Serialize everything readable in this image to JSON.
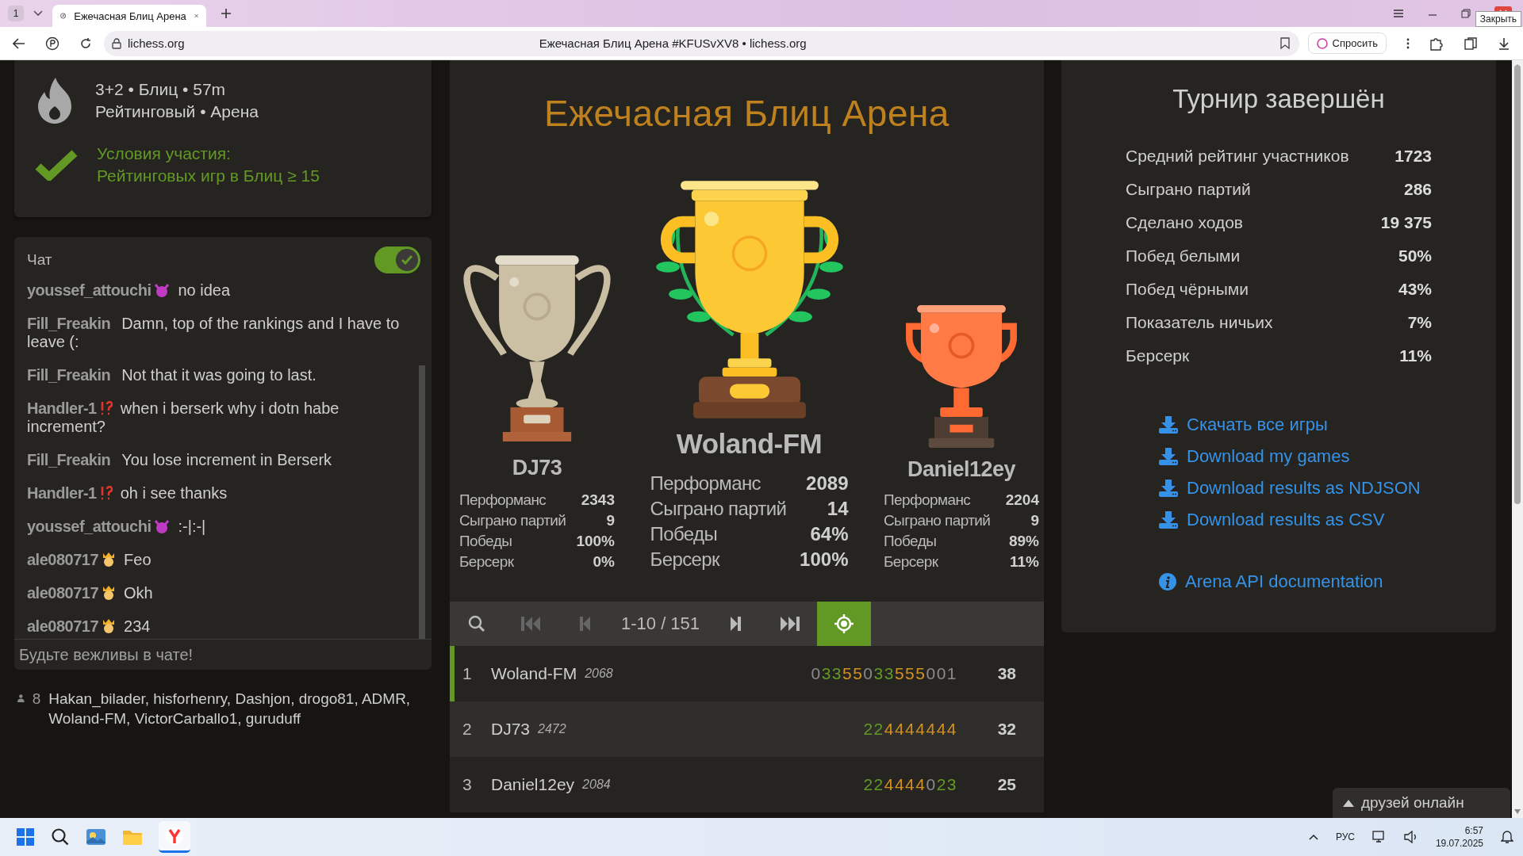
{
  "browser": {
    "tab_count": "1",
    "tabs": [
      {
        "title": "Ежечасная Блиц Арена",
        "selected": true
      }
    ],
    "url": "lichess.org",
    "page_title": "Ежечасная Блиц Арена #KFUSvXV8 • lichess.org",
    "ask_button": "Спросить",
    "tooltip": "Закрыть"
  },
  "tournament_info": {
    "line_1": "3+2 • Блиц • 57m",
    "line_2": "Рейтинговый • Арена",
    "conditions_title": "Условия участия:",
    "condition": "Рейтинговых игр в Блиц ≥ 15",
    "conditions_met": true
  },
  "chat": {
    "title": "Чат",
    "on": true,
    "placeholder": "Будьте вежливы в чате!",
    "messages": [
      {
        "user": "youssef_attouchi",
        "kind": "devil",
        "text": "no idea"
      },
      {
        "user": "Fill_Freakin",
        "kind": "plain",
        "text": "Damn, top of the rankings and I have to leave (:"
      },
      {
        "user": "Fill_Freakin",
        "kind": "plain",
        "text": "Not that it was going to last."
      },
      {
        "user": "Handler-1",
        "kind": "alert",
        "text": "when i berserk why i dotn habe increment?"
      },
      {
        "user": "Fill_Freakin",
        "kind": "plain",
        "text": "You lose increment in Berserk"
      },
      {
        "user": "Handler-1",
        "kind": "alert",
        "text": "oh i see thanks"
      },
      {
        "user": "youssef_attouchi",
        "kind": "devil",
        "text": ":-|:-|"
      },
      {
        "user": "ale080717",
        "kind": "crown",
        "text": "Feo"
      },
      {
        "user": "ale080717",
        "kind": "crown",
        "text": "Okh"
      },
      {
        "user": "ale080717",
        "kind": "crown",
        "text": "234"
      }
    ]
  },
  "members": {
    "count": "8",
    "names": "Hakan_bilader, hisforhenry, Dashjon, drogo81, ADMR, Woland-FM, VictorCarballo1, guruduff"
  },
  "podium": {
    "title": "Ежечасная Блиц Арена",
    "places": [
      {
        "kind": "silver",
        "name": "DJ73",
        "stats": [
          {
            "label": "Перформанс",
            "value": "2343"
          },
          {
            "label": "Сыграно партий",
            "value": "9"
          },
          {
            "label": "Победы",
            "value": "100%"
          },
          {
            "label": "Берсерк",
            "value": "0%"
          }
        ]
      },
      {
        "kind": "gold",
        "name": "Woland-FM",
        "stats": [
          {
            "label": "Перформанс",
            "value": "2089"
          },
          {
            "label": "Сыграно партий",
            "value": "14"
          },
          {
            "label": "Победы",
            "value": "64%"
          },
          {
            "label": "Берсерк",
            "value": "100%"
          }
        ]
      },
      {
        "kind": "bronze",
        "name": "Daniel12ey",
        "stats": [
          {
            "label": "Перформанс",
            "value": "2204"
          },
          {
            "label": "Сыграно партий",
            "value": "9"
          },
          {
            "label": "Победы",
            "value": "89%"
          },
          {
            "label": "Берсерк",
            "value": "11%"
          }
        ]
      }
    ]
  },
  "pager": {
    "left_buttons": [
      {
        "kind": "search",
        "disabled": false
      },
      {
        "kind": "first",
        "disabled": true
      },
      {
        "kind": "prev",
        "disabled": true
      }
    ],
    "range": "1-10 / 151",
    "right_buttons": [
      {
        "kind": "next",
        "disabled": false
      },
      {
        "kind": "last",
        "disabled": false
      },
      {
        "kind": "locate",
        "disabled": false,
        "selected": true
      }
    ]
  },
  "standings": [
    {
      "rank": "1",
      "name": "Woland-FM",
      "rating": "2068",
      "highlighted": true,
      "points": "38",
      "sheet": [
        {
          "digits": "0",
          "kind": "zero"
        },
        {
          "digits": "33",
          "kind": "win"
        },
        {
          "digits": "55",
          "kind": "streak"
        },
        {
          "digits": "0",
          "kind": "zero"
        },
        {
          "digits": "33",
          "kind": "win"
        },
        {
          "digits": "555",
          "kind": "streak"
        },
        {
          "digits": "001",
          "kind": "zero"
        }
      ]
    },
    {
      "rank": "2",
      "name": "DJ73",
      "rating": "2472",
      "highlighted": false,
      "points": "32",
      "sheet": [
        {
          "digits": "22",
          "kind": "win"
        },
        {
          "digits": "4444444",
          "kind": "streak"
        }
      ]
    },
    {
      "rank": "3",
      "name": "Daniel12ey",
      "rating": "2084",
      "highlighted": false,
      "points": "25",
      "sheet": [
        {
          "digits": "22",
          "kind": "win"
        },
        {
          "digits": "4444",
          "kind": "streak"
        },
        {
          "digits": "0",
          "kind": "zero"
        },
        {
          "digits": "23",
          "kind": "win"
        }
      ]
    }
  ],
  "summary": {
    "title": "Турнир завершён",
    "stats": [
      {
        "label": "Средний рейтинг участников",
        "value": "1723"
      },
      {
        "label": "Сыграно партий",
        "value": "286"
      },
      {
        "label": "Сделано ходов",
        "value": "19 375"
      },
      {
        "label": "Побед белыми",
        "value": "50%"
      },
      {
        "label": "Побед чёрными",
        "value": "43%"
      },
      {
        "label": "Показатель ничьих",
        "value": "7%"
      },
      {
        "label": "Берсерк",
        "value": "11%"
      }
    ],
    "links": [
      {
        "kind": "download",
        "label": "Скачать все игры"
      },
      {
        "kind": "download",
        "label": "Download my games"
      },
      {
        "kind": "download",
        "label": "Download results as NDJSON"
      },
      {
        "kind": "download",
        "label": "Download results as CSV"
      },
      {
        "kind": "info",
        "label": "Arena API documentation"
      }
    ]
  },
  "friends_online": {
    "label": "друзей онлайн"
  },
  "taskbar": {
    "language": "РУС",
    "time": "6:57",
    "date": "19.07.2025"
  }
}
